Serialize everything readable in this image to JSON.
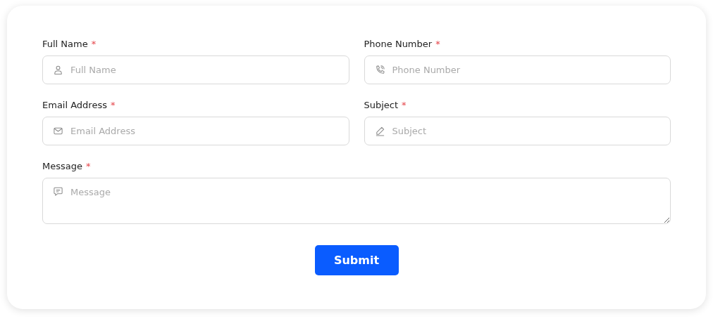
{
  "rows": [
    {
      "fields": [
        {
          "label": "Full Name",
          "required_mark": "*",
          "placeholder": "Full Name",
          "kind": "input"
        },
        {
          "label": "Phone Number",
          "required_mark": "*",
          "placeholder": "Phone Number",
          "kind": "input"
        }
      ]
    },
    {
      "fields": [
        {
          "label": "Email Address",
          "required_mark": "*",
          "placeholder": "Email Address",
          "kind": "input"
        },
        {
          "label": "Subject",
          "required_mark": "*",
          "placeholder": "Subject",
          "kind": "input"
        }
      ]
    },
    {
      "fields": [
        {
          "label": "Message",
          "required_mark": "*",
          "placeholder": "Message",
          "kind": "textarea"
        }
      ]
    }
  ],
  "submit": {
    "label": "Submit"
  }
}
